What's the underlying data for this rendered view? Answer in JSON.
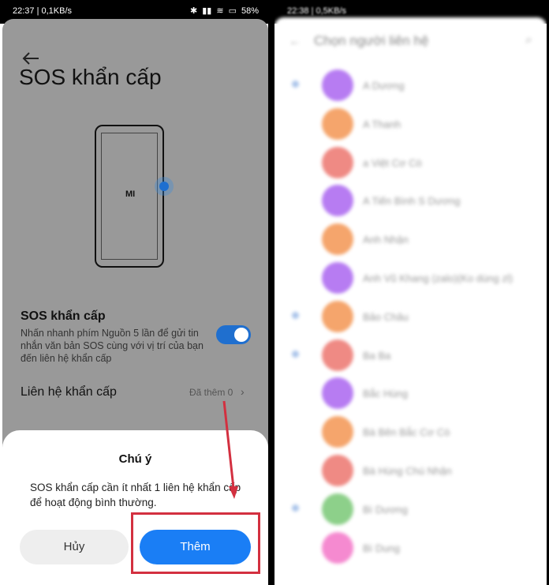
{
  "left": {
    "status": {
      "time": "22:37 | 0,1KB/s",
      "battery": "58%"
    },
    "page_title": "SOS khẩn cấp",
    "phone_logo": "MI",
    "sos": {
      "title": "SOS khẩn cấp",
      "description": "Nhấn nhanh phím Nguồn 5 lần để gửi tin nhắn văn bản SOS cùng với vị trí của bạn đến liên hệ khẩn cấp",
      "enabled": true
    },
    "contact_row": {
      "label": "Liên hệ khẩn cấp",
      "value": "Đã thêm 0",
      "chevron": "›"
    },
    "dialog": {
      "title": "Chú ý",
      "message": "SOS khẩn cấp cần ít nhất 1 liên hệ khẩn cấp để hoạt động bình thường.",
      "cancel_label": "Hủy",
      "add_label": "Thêm"
    },
    "colors": {
      "accent": "#1a7ef5",
      "highlight": "#d33040",
      "toggle": "#1f6fcf"
    }
  },
  "right": {
    "status": {
      "time": "22:38 | 0,5KB/s"
    },
    "header_title": "Chọn người liên hệ",
    "contacts": [
      {
        "name": "A Dương",
        "color": "#b77cf2",
        "checked": true
      },
      {
        "name": "A Thanh",
        "color": "#f5a56c",
        "checked": false
      },
      {
        "name": "a Việt Cơ Cò",
        "color": "#ef8a84",
        "checked": false
      },
      {
        "name": "A Tiến Bình S Dương",
        "color": "#b77cf2",
        "checked": false
      },
      {
        "name": "Anh Nhận",
        "color": "#f5a56c",
        "checked": false
      },
      {
        "name": "Anh Vũ Khang (zalo)(Ko dùng zl)",
        "color": "#b77cf2",
        "checked": false
      },
      {
        "name": "Bảo Châu",
        "color": "#f5a56c",
        "checked": true
      },
      {
        "name": "Ba Ba",
        "color": "#ef8a84",
        "checked": true
      },
      {
        "name": "Bắc Hùng",
        "color": "#b77cf2",
        "checked": false
      },
      {
        "name": "Bà Bên Bắc Cơ Cò",
        "color": "#f5a56c",
        "checked": false
      },
      {
        "name": "Bà Hùng Chú Nhận",
        "color": "#ef8a84",
        "checked": false
      },
      {
        "name": "Bì Dương",
        "color": "#8dd08a",
        "checked": true
      },
      {
        "name": "Bì Dung",
        "color": "#f58ad0",
        "checked": false
      }
    ]
  }
}
